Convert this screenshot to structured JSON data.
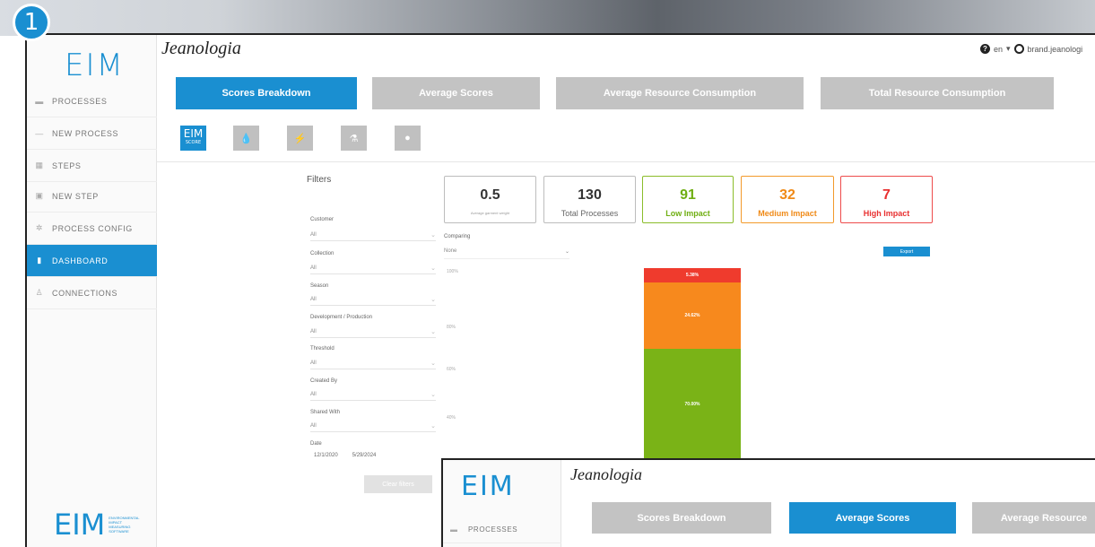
{
  "step_number": "1",
  "app": {
    "logo_text": "EIM",
    "brand": "Jeanologia"
  },
  "header": {
    "help_label": "?",
    "language": "en",
    "user": "brand.jeanologi"
  },
  "sidebar": {
    "items": [
      {
        "label": "PROCESSES",
        "icon": "list-icon"
      },
      {
        "label": "NEW PROCESS",
        "icon": "plus-line-icon"
      },
      {
        "label": "STEPS",
        "icon": "grid-icon"
      },
      {
        "label": "NEW STEP",
        "icon": "add-square-icon"
      },
      {
        "label": "PROCESS CONFIG",
        "icon": "gear-icon"
      },
      {
        "label": "DASHBOARD",
        "icon": "bar-chart-icon",
        "active": true
      },
      {
        "label": "CONNECTIONS",
        "icon": "person-icon"
      }
    ],
    "footer_logo": "EIM",
    "footer_tagline": "ENVIRONMENTAL IMPACT MEASURING SOFTWARE"
  },
  "tabs": [
    {
      "label": "Scores Breakdown",
      "active": true
    },
    {
      "label": "Average Scores",
      "active": false
    },
    {
      "label": "Average Resource Consumption",
      "active": false
    },
    {
      "label": "Total Resource Consumption",
      "active": false
    }
  ],
  "icon_tabs": [
    {
      "name": "eim-score-icon",
      "label": "EIM",
      "sublabel": "SCORE",
      "active": true
    },
    {
      "name": "water-icon",
      "label": "💧",
      "active": false
    },
    {
      "name": "energy-icon",
      "label": "⚡",
      "active": false
    },
    {
      "name": "chemicals-icon",
      "label": "⚗",
      "active": false
    },
    {
      "name": "worker-icon",
      "label": "●",
      "active": false
    }
  ],
  "filters": {
    "title": "Filters",
    "fields": [
      {
        "label": "Customer",
        "value": "All"
      },
      {
        "label": "Collection",
        "value": "All"
      },
      {
        "label": "Season",
        "value": "All"
      },
      {
        "label": "Development / Production",
        "value": "All"
      },
      {
        "label": "Threshold",
        "value": "All"
      },
      {
        "label": "Created By",
        "value": "All"
      },
      {
        "label": "Shared With",
        "value": "All"
      }
    ],
    "date_label": "Date",
    "date_from": "12/1/2020",
    "date_to": "5/29/2024",
    "clear_label": "Clear filters"
  },
  "scores": {
    "average": {
      "value": "0.5",
      "label": "Average garment weight"
    },
    "total": {
      "value": "130",
      "label": "Total Processes"
    },
    "low": {
      "value": "91",
      "label": "Low Impact",
      "color": "#6fae12"
    },
    "medium": {
      "value": "32",
      "label": "Medium Impact",
      "color": "#f08a17"
    },
    "high": {
      "value": "7",
      "label": "High Impact",
      "color": "#e83030"
    }
  },
  "comparing": {
    "label": "Comparing",
    "value": "None"
  },
  "export_label": "Export",
  "chart_data": {
    "type": "bar",
    "categories": [
      ""
    ],
    "series": [
      {
        "name": "Low Impact",
        "values": [
          70.0
        ],
        "color": "#7ab317"
      },
      {
        "name": "Medium Impact",
        "values": [
          24.6
        ],
        "color": "#f7891d"
      },
      {
        "name": "High Impact",
        "values": [
          5.4
        ],
        "color": "#ef3b2d"
      }
    ],
    "stacked": true,
    "ylim": [
      0,
      100
    ],
    "yticks": [
      "100%",
      "80%",
      "60%",
      "40%"
    ],
    "data_labels": [
      "70.00%",
      "24.62%",
      "5.38%"
    ]
  },
  "overlay": {
    "logo_text": "EIM",
    "brand": "Jeanologia",
    "sidebar_item": "PROCESSES",
    "tabs": [
      {
        "label": "Scores Breakdown",
        "active": false
      },
      {
        "label": "Average Scores",
        "active": true
      },
      {
        "label": "Average Resource",
        "active": false
      }
    ]
  }
}
